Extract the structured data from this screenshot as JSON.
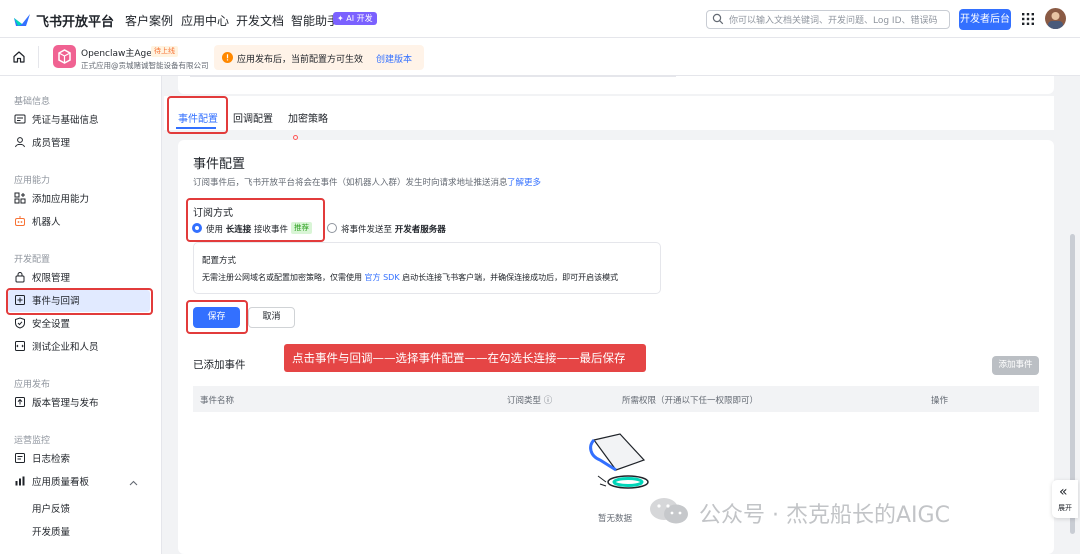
{
  "topbar": {
    "brand": "飞书开放平台",
    "nav": [
      "客户案例",
      "应用中心",
      "开发文档",
      "智能助手"
    ],
    "ai_badge": "✦ AI 开发",
    "search_placeholder": "你可以输入文档关键词、开发问题、Log ID、错误码",
    "dev_console_label": "开发者后台"
  },
  "appbar": {
    "app_name": "Openclaw主Agent",
    "app_status": "待上线",
    "app_company": "正式应用@贡城赌诚智能设备有限公司",
    "notice_text": "应用发布后，当前配置方可生效",
    "notice_link": "创建版本"
  },
  "sidebar": {
    "sections": [
      {
        "title": "基础信息",
        "items": [
          {
            "label": "凭证与基础信息",
            "icon": "id-card-icon"
          },
          {
            "label": "成员管理",
            "icon": "user-icon"
          }
        ]
      },
      {
        "title": "应用能力",
        "items": [
          {
            "label": "添加应用能力",
            "icon": "apps-add-icon"
          },
          {
            "label": "机器人",
            "icon": "robot-icon"
          }
        ]
      },
      {
        "title": "开发配置",
        "items": [
          {
            "label": "权限管理",
            "icon": "lock-icon"
          },
          {
            "label": "事件与回调",
            "icon": "event-icon"
          },
          {
            "label": "安全设置",
            "icon": "shield-icon"
          },
          {
            "label": "测试企业和人员",
            "icon": "test-icon"
          }
        ]
      },
      {
        "title": "应用发布",
        "items": [
          {
            "label": "版本管理与发布",
            "icon": "upload-icon"
          }
        ]
      },
      {
        "title": "运营监控",
        "items": [
          {
            "label": "日志检索",
            "icon": "log-icon"
          },
          {
            "label": "应用质量看板",
            "icon": "chart-icon"
          }
        ]
      }
    ],
    "quality_subitems": [
      "用户反馈",
      "开发质量"
    ],
    "active_item": "事件与回调"
  },
  "tabs": [
    "事件配置",
    "回调配置",
    "加密策略"
  ],
  "event_config": {
    "title": "事件配置",
    "desc": "订阅事件后，飞书开放平台将会在事件（如机器人入群）发生时向请求地址推送消息",
    "learn_more": "了解更多",
    "subscribe_label": "订阅方式",
    "option1_prefix": "使用",
    "option1_bold": "长连接",
    "option1_suffix": "接收事件",
    "option1_tag": "推荐",
    "option2_prefix": "将事件发送至",
    "option2_bold": "开发者服务器",
    "conf_title": "配置方式",
    "conf_desc_prefix": "无需注册公网域名或配置加密策略，仅需使用",
    "conf_desc_link": "官方 SDK",
    "conf_desc_suffix": "启动长连接飞书客户端，并确保连接成功后，即可开启该模式",
    "save_label": "保存",
    "cancel_label": "取消"
  },
  "added_events": {
    "title": "已添加事件",
    "add_button": "添加事件",
    "columns": [
      "事件名称",
      "订阅类型 ⓘ",
      "所需权限（开通以下任一权限即可）",
      "操作"
    ],
    "empty_text": "暂无数据"
  },
  "annotation": "点击事件与回调——选择事件配置——在勾选长连接——最后保存",
  "expand": {
    "icon": "«",
    "label": "展开"
  },
  "watermark": "公众号 · 杰克船长的AIGC",
  "colors": {
    "primary": "#3370ff",
    "annotation_red": "#e54545"
  }
}
